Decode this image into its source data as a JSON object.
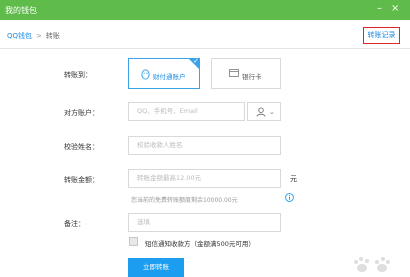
{
  "window": {
    "title": "我的钱包",
    "minimize_symbol": "–",
    "close_symbol": "×"
  },
  "breadcrumb": {
    "home": "QQ钱包",
    "separator": ">",
    "current": "转账"
  },
  "header": {
    "record_link": "转账记录"
  },
  "form": {
    "to_label": "转账到：",
    "methods": [
      {
        "label": "财付通账户",
        "icon": "penguin-icon",
        "selected": true
      },
      {
        "label": "银行卡",
        "icon": "bank-card-icon",
        "selected": false
      }
    ],
    "account_label": "对方账户：",
    "account_placeholder": "QQ、手机号、Email",
    "name_label": "校验姓名：",
    "name_placeholder": "校验收款人姓名",
    "amount_label": "转账金额：",
    "amount_placeholder": "转账金额最高12.00元",
    "amount_unit": "元",
    "amount_hint": "您当前的免费转账额度剩余10000.00元",
    "note_label": "备注：",
    "note_placeholder": "选填",
    "sms_label": "短信通知收款方（金额满500元可用）",
    "sms_checked": false,
    "submit_label": "立即转账"
  },
  "colors": {
    "titlebar": "#5fbb4a",
    "accent": "#1d9df0",
    "link": "#1d8ae0",
    "highlight_border": "#e0242a"
  }
}
